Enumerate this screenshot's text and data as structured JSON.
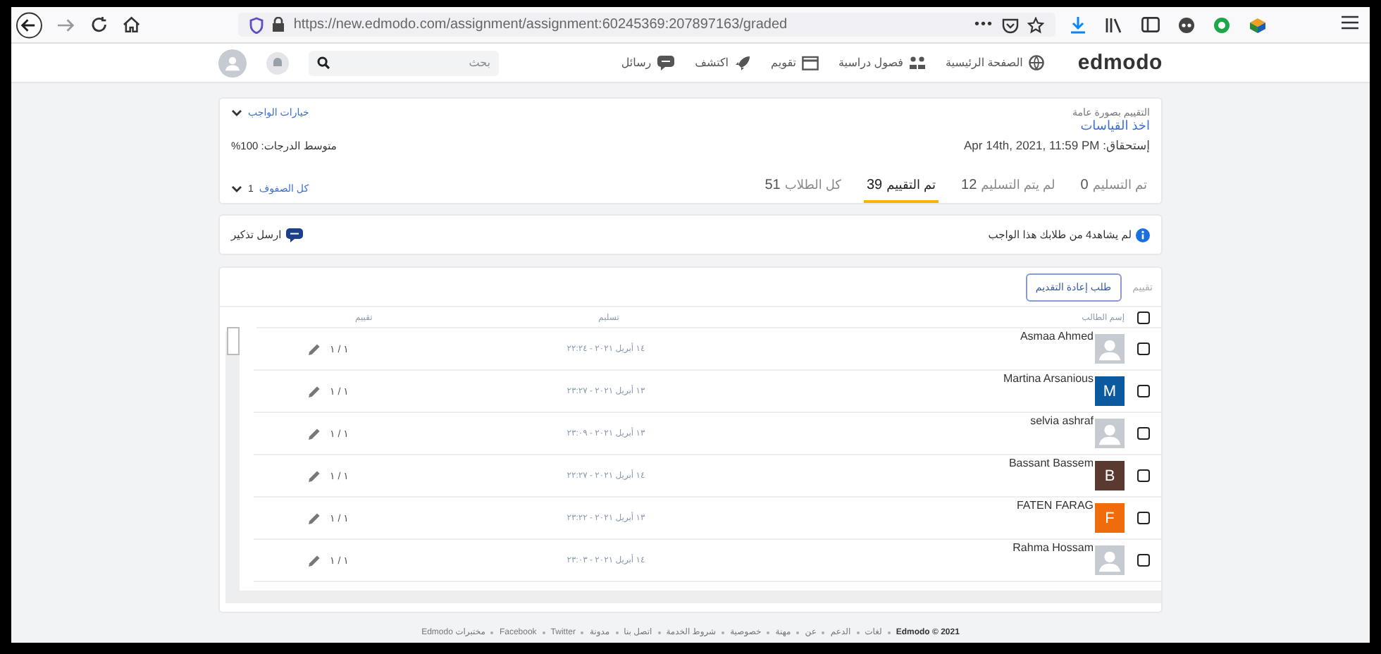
{
  "browser": {
    "url": "https://new.edmodo.com/assignment/assignment:60245369:207897163/graded",
    "page_menu": "•••"
  },
  "nav": {
    "logo": "edmodo",
    "items": [
      {
        "label": "الصفحة الرئيسية",
        "kind": "home"
      },
      {
        "label": "فصول دراسية",
        "kind": "classes"
      },
      {
        "label": "تقويم",
        "kind": "calendar"
      },
      {
        "label": "اكتشف",
        "kind": "discover"
      },
      {
        "label": "رسائل",
        "kind": "messages"
      }
    ],
    "search": {
      "placeholder": "بحث"
    }
  },
  "assignment": {
    "heading": "التقييم بصورة عامة",
    "title": "اخذ القياسات",
    "due": "إستحقاق: Apr 14th, 2021, 11:59 PM",
    "options": "خيارات الواجب",
    "average": "متوسط الدرجات: 100%"
  },
  "tabs": [
    {
      "count": "0",
      "label": "تم التسليم",
      "selected": false
    },
    {
      "count": "12",
      "label": "لم يتم التسليم",
      "selected": false
    },
    {
      "count": "39",
      "label": "تم التقييم",
      "selected": true
    },
    {
      "count": "51",
      "label": "كل الطلاب",
      "selected": false
    }
  ],
  "sections_filter": {
    "label": "كل الصفوف",
    "count": "1"
  },
  "notice": {
    "text": "لم يشاهد4 من طلابك هذا الواجب",
    "action": "ارسل تذكير"
  },
  "toolbar": {
    "grade": {
      "label": "تقييم",
      "disabled": true
    },
    "resubmit": "طلب إعادة التقديم"
  },
  "table": {
    "select_all": {
      "checked": false
    },
    "columns": [
      "إسم الطالب",
      "تسليم",
      "تقييم"
    ],
    "rows": [
      {
        "name": "Asmaa Ahmed",
        "kind": "placeholder",
        "submitted": "١٤ أبريل ٢٠٢١ - ٢٢:٢٤",
        "grade": "١ / ١",
        "checked": false
      },
      {
        "name": "Martina Arsanious",
        "kind": "initial",
        "initial": "M",
        "color": "#0b5aa0",
        "submitted": "١٣ أبريل ٢٠٢١ - ٢٣:٢٧",
        "grade": "١ / ١",
        "checked": false
      },
      {
        "name": "selvia ashraf",
        "kind": "placeholder",
        "submitted": "١٣ أبريل ٢٠٢١ - ٢٣:٠٩",
        "grade": "١ / ١",
        "checked": false
      },
      {
        "name": "Bassant Bassem",
        "kind": "initial",
        "initial": "B",
        "color": "#5a3a30",
        "submitted": "١٤ أبريل ٢٠٢١ - ٢٢:٢٧",
        "grade": "١ / ١",
        "checked": false
      },
      {
        "name": "FATEN FARAG",
        "kind": "initial",
        "initial": "F",
        "color": "#ee6c0c",
        "submitted": "١٣ أبريل ٢٠٢١ - ٢٣:٢٢",
        "grade": "١ / ١",
        "checked": false
      },
      {
        "name": "Rahma Hossam",
        "kind": "placeholder",
        "submitted": "١٤ أبريل ٢٠٢١ - ٢٣:٠٣",
        "grade": "١ / ١",
        "checked": false
      }
    ]
  },
  "footer": {
    "copyright": "Edmodo © 2021",
    "links": [
      "لغات",
      "الدعم",
      "عن",
      "مهنة",
      "خصوصية",
      "شروط الخدمة",
      "اتصل بنا",
      "مدونة",
      "Twitter",
      "Facebook",
      "مختبرات Edmodo"
    ]
  }
}
